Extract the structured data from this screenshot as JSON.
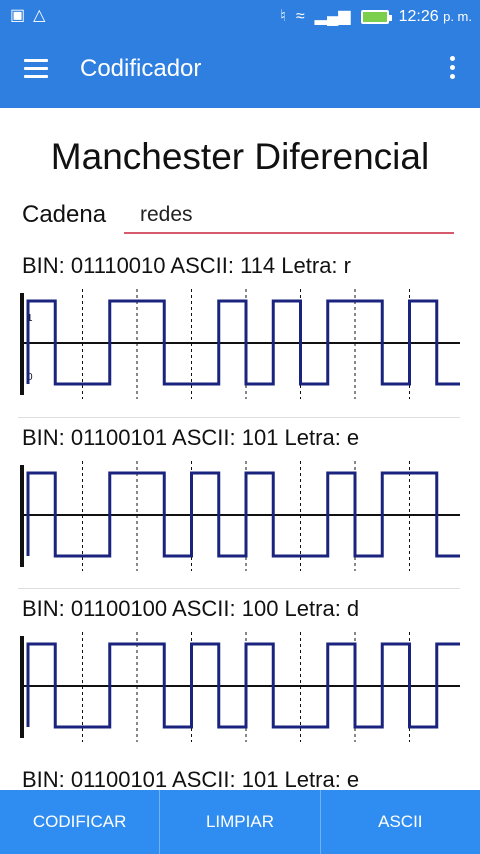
{
  "status_bar": {
    "time": "12:26",
    "ampm": "p. m."
  },
  "app_bar": {
    "title": "Codificador"
  },
  "main": {
    "title": "Manchester Diferencial",
    "input_label": "Cadena",
    "input_value": "redes"
  },
  "chart_data": [
    {
      "type": "line",
      "title": "BIN: 01110010 ASCII: 114 Letra: r",
      "bits": "01110010",
      "y_ticks": [
        "1",
        "0"
      ]
    },
    {
      "type": "line",
      "title": "BIN: 01100101 ASCII: 101 Letra: e",
      "bits": "01100101",
      "y_ticks": []
    },
    {
      "type": "line",
      "title": "BIN: 01100100 ASCII: 100 Letra: d",
      "bits": "01100100",
      "y_ticks": []
    },
    {
      "type": "line",
      "title": "BIN: 01100101 ASCII: 101 Letra: e",
      "bits": "01100101",
      "y_ticks": []
    }
  ],
  "bottom_bar": {
    "encode": "CODIFICAR",
    "clear": "LIMPIAR",
    "ascii": "ASCII"
  },
  "colors": {
    "primary": "#2f7fe0",
    "signal": "#1a237e",
    "accent_underline": "#d6596d"
  }
}
